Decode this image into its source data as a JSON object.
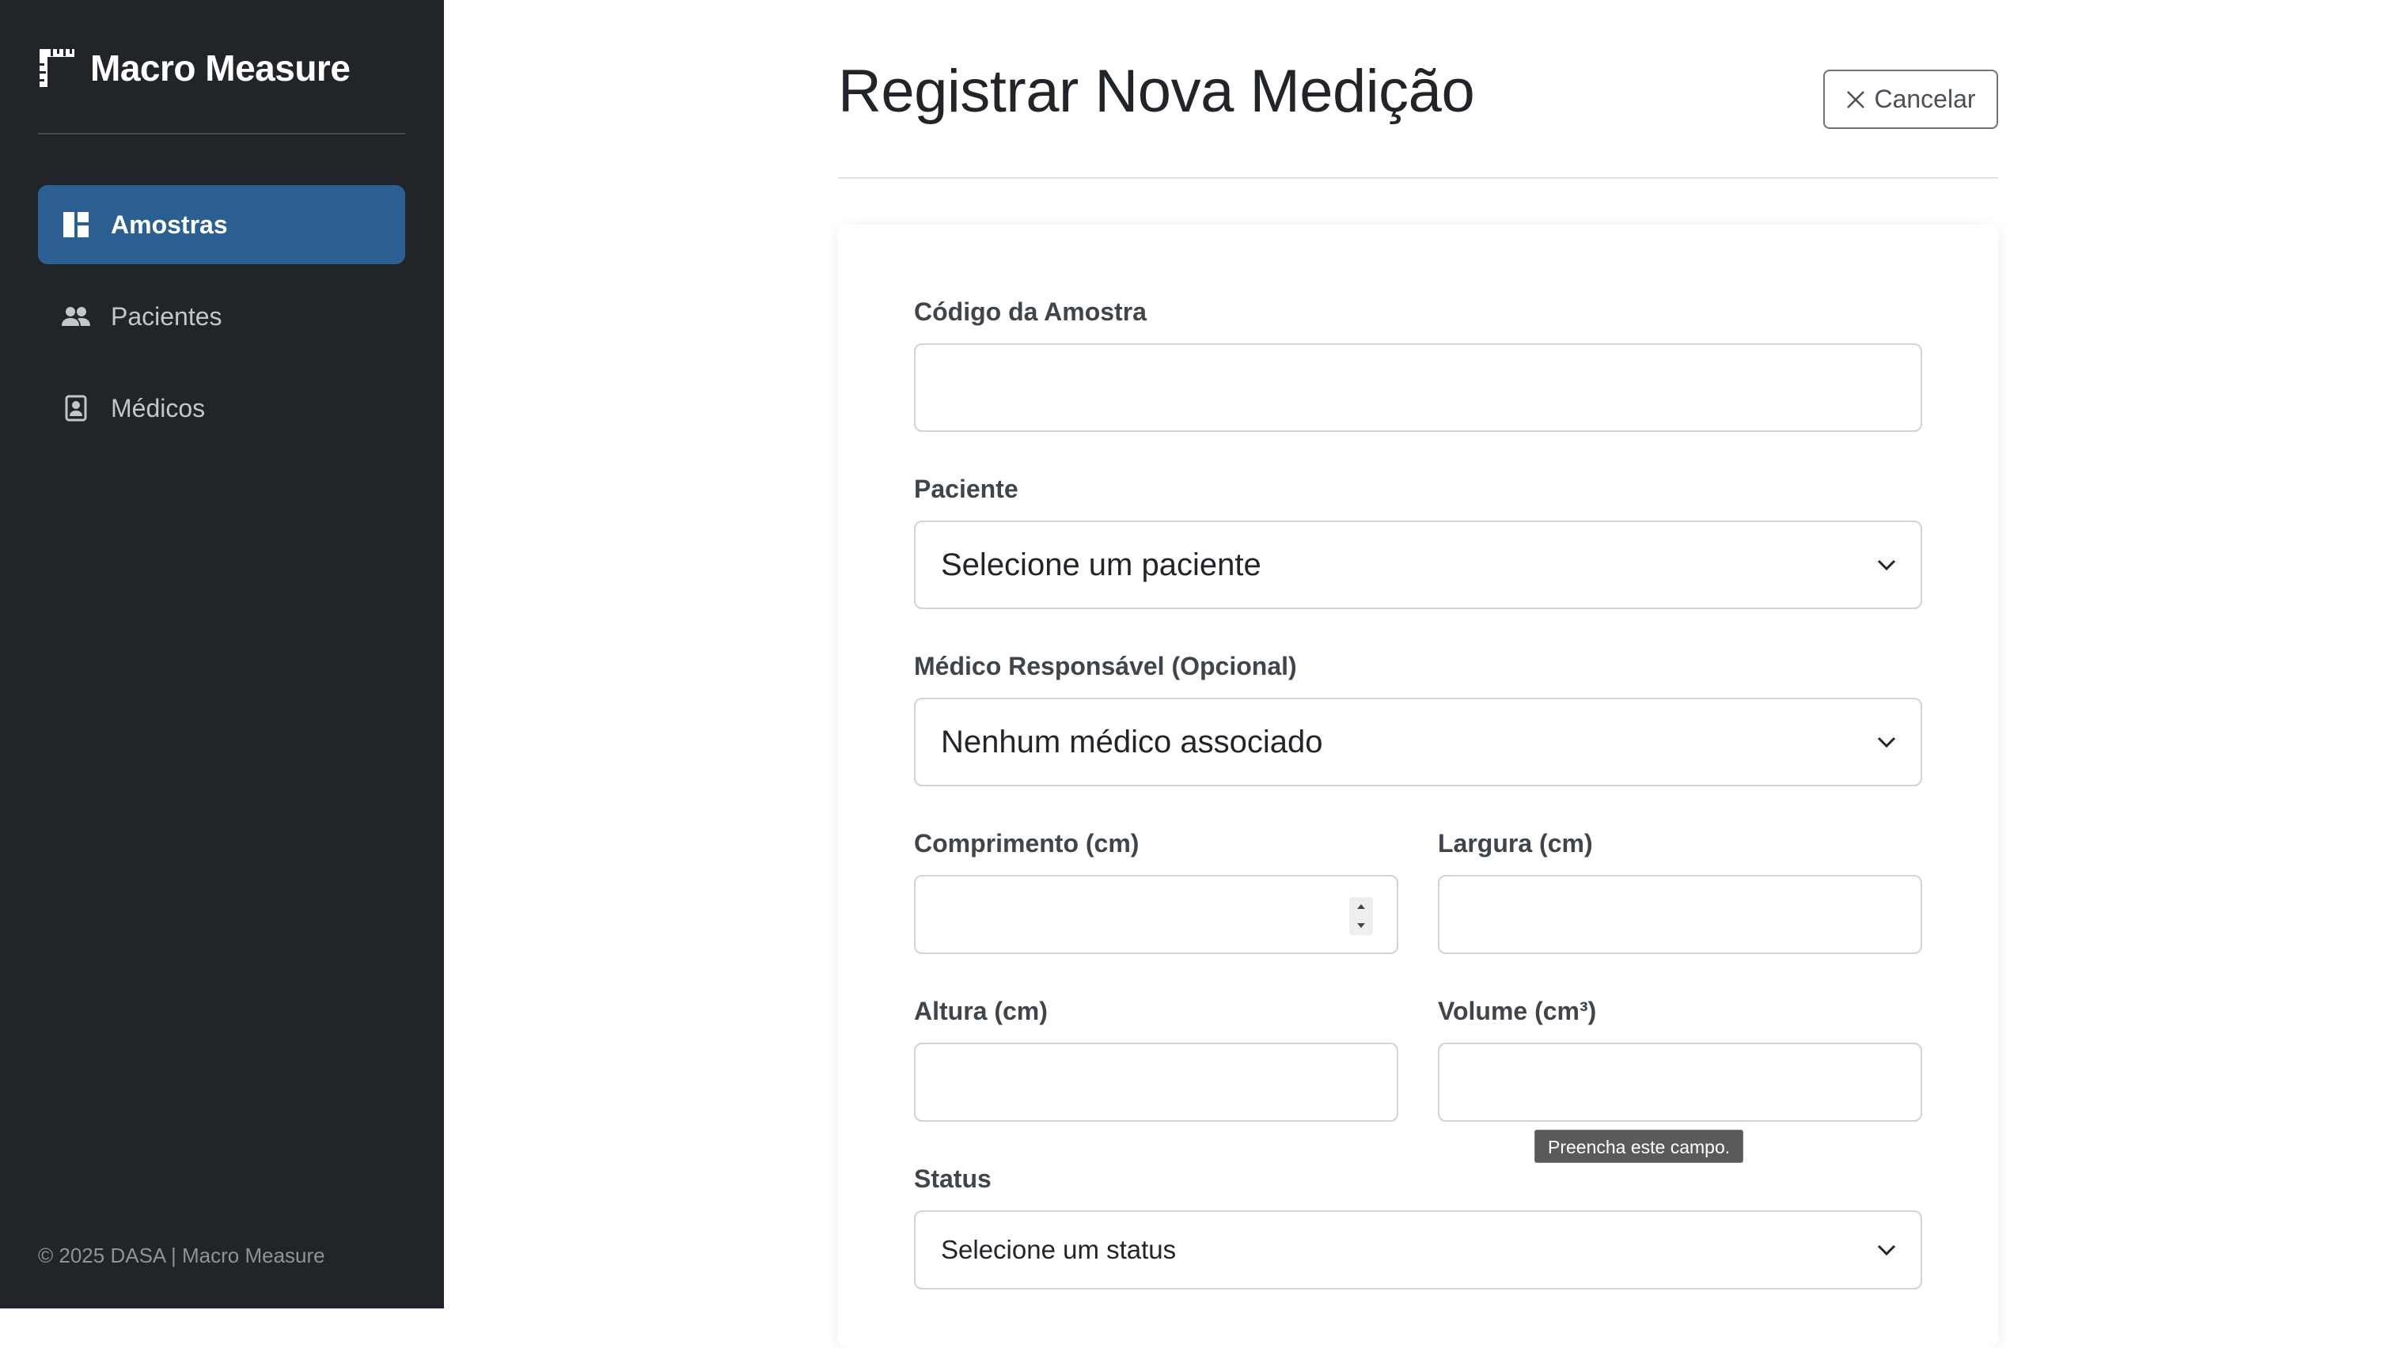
{
  "app": {
    "title": "Macro Measure",
    "footer": "© 2025 DASA | Macro Measure"
  },
  "sidebar": {
    "items": [
      {
        "label": "Amostras",
        "icon": "dashboard-icon",
        "active": true
      },
      {
        "label": "Pacientes",
        "icon": "people-icon",
        "active": false
      },
      {
        "label": "Médicos",
        "icon": "badge-icon",
        "active": false
      }
    ]
  },
  "header": {
    "title": "Registrar Nova Medição",
    "cancel_label": "Cancelar"
  },
  "form": {
    "sample_code": {
      "label": "Código da Amostra",
      "value": ""
    },
    "patient": {
      "label": "Paciente",
      "selected": "Selecione um paciente"
    },
    "doctor": {
      "label": "Médico Responsável (Opcional)",
      "selected": "Nenhum médico associado"
    },
    "length": {
      "label": "Comprimento (cm)",
      "value": ""
    },
    "width": {
      "label": "Largura (cm)",
      "value": ""
    },
    "height": {
      "label": "Altura (cm)",
      "value": ""
    },
    "volume": {
      "label": "Volume (cm³)",
      "value": ""
    },
    "status": {
      "label": "Status",
      "selected": "Selecione um status"
    }
  },
  "tooltip": {
    "text": "Preencha este campo."
  },
  "colors": {
    "sidebar_bg": "#212529",
    "active_item": "#2c5f91"
  }
}
